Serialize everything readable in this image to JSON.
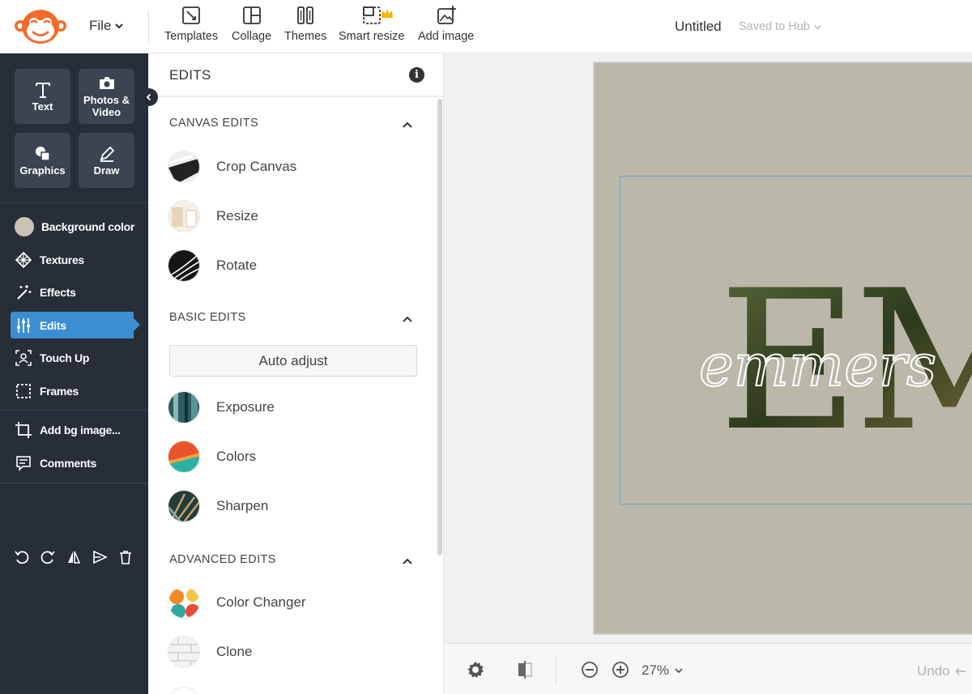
{
  "header": {
    "file_menu": "File",
    "tools": [
      {
        "label": "Templates",
        "icon": "templates-icon"
      },
      {
        "label": "Collage",
        "icon": "collage-icon"
      },
      {
        "label": "Themes",
        "icon": "themes-icon"
      },
      {
        "label": "Smart resize",
        "icon": "smart-resize-icon"
      },
      {
        "label": "Add image",
        "icon": "add-image-icon"
      }
    ],
    "doc_title": "Untitled",
    "save_status": "Saved to Hub"
  },
  "rail": {
    "big_buttons": [
      {
        "label": "Text",
        "icon": "text-icon"
      },
      {
        "label": "Photos & Video",
        "icon": "camera-icon"
      },
      {
        "label": "Graphics",
        "icon": "graphics-icon"
      },
      {
        "label": "Draw",
        "icon": "pen-icon"
      }
    ],
    "items": [
      {
        "label": "Background color",
        "icon": "swatch"
      },
      {
        "label": "Textures",
        "icon": "textures-icon"
      },
      {
        "label": "Effects",
        "icon": "magic-wand-icon"
      },
      {
        "label": "Edits",
        "icon": "sliders-icon",
        "active": true
      },
      {
        "label": "Touch Up",
        "icon": "face-scan-icon"
      },
      {
        "label": "Frames",
        "icon": "frame-icon"
      },
      {
        "label": "Add bg image...",
        "icon": "crop-icon"
      },
      {
        "label": "Comments",
        "icon": "comment-icon"
      }
    ],
    "background_swatch_color": "#c9c3b6",
    "accent": "#3a8fd0"
  },
  "panel": {
    "title": "EDITS",
    "sections": [
      {
        "title": "CANVAS EDITS",
        "items": [
          "Crop Canvas",
          "Resize",
          "Rotate"
        ]
      },
      {
        "title": "BASIC EDITS",
        "button": "Auto adjust",
        "items": [
          "Exposure",
          "Colors",
          "Sharpen"
        ]
      },
      {
        "title": "ADVANCED EDITS",
        "items": [
          "Color Changer",
          "Clone"
        ]
      }
    ]
  },
  "canvas": {
    "background_color": "#bbb8aa",
    "art_letters": "EM",
    "art_script": "emmers"
  },
  "footer": {
    "zoom": "27%",
    "undo": "Undo"
  }
}
